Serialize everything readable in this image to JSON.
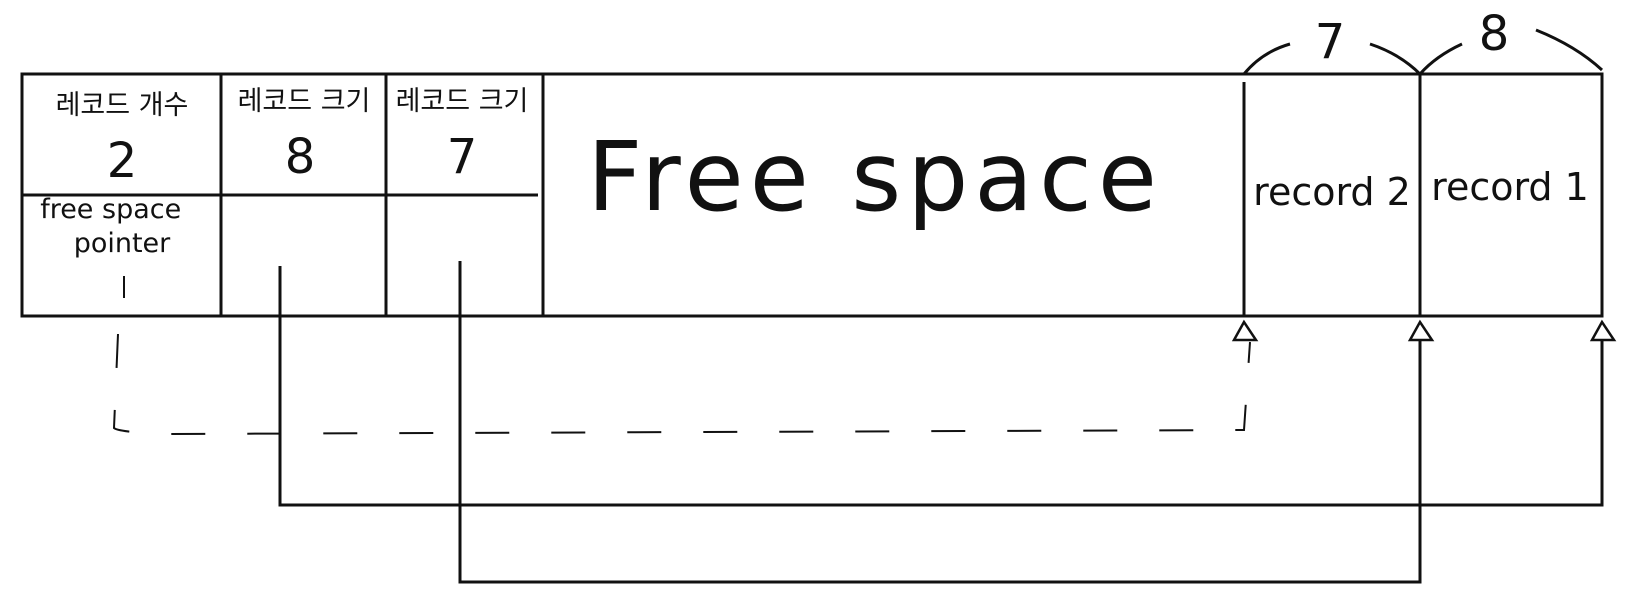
{
  "header_cells": [
    {
      "label": "레코드 개수",
      "value": "2"
    },
    {
      "label": "레코드 크기",
      "value": "8"
    },
    {
      "label": "레코드 크기",
      "value": "7"
    }
  ],
  "free_space_pointer_label": "free space pointer",
  "free_space_label": "Free   space",
  "records": [
    {
      "label": "record 2",
      "size": "7"
    },
    {
      "label": "record 1",
      "size": "8"
    }
  ],
  "colors": {
    "stroke": "#111111",
    "background": "#ffffff"
  }
}
